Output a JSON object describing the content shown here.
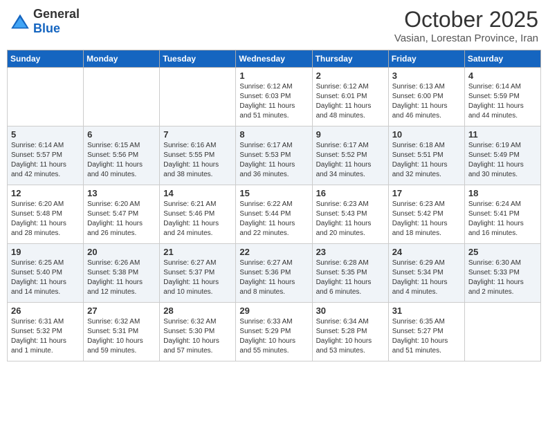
{
  "header": {
    "logo_general": "General",
    "logo_blue": "Blue",
    "month": "October 2025",
    "location": "Vasian, Lorestan Province, Iran"
  },
  "weekdays": [
    "Sunday",
    "Monday",
    "Tuesday",
    "Wednesday",
    "Thursday",
    "Friday",
    "Saturday"
  ],
  "weeks": [
    [
      {
        "day": "",
        "detail": ""
      },
      {
        "day": "",
        "detail": ""
      },
      {
        "day": "",
        "detail": ""
      },
      {
        "day": "1",
        "detail": "Sunrise: 6:12 AM\nSunset: 6:03 PM\nDaylight: 11 hours\nand 51 minutes."
      },
      {
        "day": "2",
        "detail": "Sunrise: 6:12 AM\nSunset: 6:01 PM\nDaylight: 11 hours\nand 48 minutes."
      },
      {
        "day": "3",
        "detail": "Sunrise: 6:13 AM\nSunset: 6:00 PM\nDaylight: 11 hours\nand 46 minutes."
      },
      {
        "day": "4",
        "detail": "Sunrise: 6:14 AM\nSunset: 5:59 PM\nDaylight: 11 hours\nand 44 minutes."
      }
    ],
    [
      {
        "day": "5",
        "detail": "Sunrise: 6:14 AM\nSunset: 5:57 PM\nDaylight: 11 hours\nand 42 minutes."
      },
      {
        "day": "6",
        "detail": "Sunrise: 6:15 AM\nSunset: 5:56 PM\nDaylight: 11 hours\nand 40 minutes."
      },
      {
        "day": "7",
        "detail": "Sunrise: 6:16 AM\nSunset: 5:55 PM\nDaylight: 11 hours\nand 38 minutes."
      },
      {
        "day": "8",
        "detail": "Sunrise: 6:17 AM\nSunset: 5:53 PM\nDaylight: 11 hours\nand 36 minutes."
      },
      {
        "day": "9",
        "detail": "Sunrise: 6:17 AM\nSunset: 5:52 PM\nDaylight: 11 hours\nand 34 minutes."
      },
      {
        "day": "10",
        "detail": "Sunrise: 6:18 AM\nSunset: 5:51 PM\nDaylight: 11 hours\nand 32 minutes."
      },
      {
        "day": "11",
        "detail": "Sunrise: 6:19 AM\nSunset: 5:49 PM\nDaylight: 11 hours\nand 30 minutes."
      }
    ],
    [
      {
        "day": "12",
        "detail": "Sunrise: 6:20 AM\nSunset: 5:48 PM\nDaylight: 11 hours\nand 28 minutes."
      },
      {
        "day": "13",
        "detail": "Sunrise: 6:20 AM\nSunset: 5:47 PM\nDaylight: 11 hours\nand 26 minutes."
      },
      {
        "day": "14",
        "detail": "Sunrise: 6:21 AM\nSunset: 5:46 PM\nDaylight: 11 hours\nand 24 minutes."
      },
      {
        "day": "15",
        "detail": "Sunrise: 6:22 AM\nSunset: 5:44 PM\nDaylight: 11 hours\nand 22 minutes."
      },
      {
        "day": "16",
        "detail": "Sunrise: 6:23 AM\nSunset: 5:43 PM\nDaylight: 11 hours\nand 20 minutes."
      },
      {
        "day": "17",
        "detail": "Sunrise: 6:23 AM\nSunset: 5:42 PM\nDaylight: 11 hours\nand 18 minutes."
      },
      {
        "day": "18",
        "detail": "Sunrise: 6:24 AM\nSunset: 5:41 PM\nDaylight: 11 hours\nand 16 minutes."
      }
    ],
    [
      {
        "day": "19",
        "detail": "Sunrise: 6:25 AM\nSunset: 5:40 PM\nDaylight: 11 hours\nand 14 minutes."
      },
      {
        "day": "20",
        "detail": "Sunrise: 6:26 AM\nSunset: 5:38 PM\nDaylight: 11 hours\nand 12 minutes."
      },
      {
        "day": "21",
        "detail": "Sunrise: 6:27 AM\nSunset: 5:37 PM\nDaylight: 11 hours\nand 10 minutes."
      },
      {
        "day": "22",
        "detail": "Sunrise: 6:27 AM\nSunset: 5:36 PM\nDaylight: 11 hours\nand 8 minutes."
      },
      {
        "day": "23",
        "detail": "Sunrise: 6:28 AM\nSunset: 5:35 PM\nDaylight: 11 hours\nand 6 minutes."
      },
      {
        "day": "24",
        "detail": "Sunrise: 6:29 AM\nSunset: 5:34 PM\nDaylight: 11 hours\nand 4 minutes."
      },
      {
        "day": "25",
        "detail": "Sunrise: 6:30 AM\nSunset: 5:33 PM\nDaylight: 11 hours\nand 2 minutes."
      }
    ],
    [
      {
        "day": "26",
        "detail": "Sunrise: 6:31 AM\nSunset: 5:32 PM\nDaylight: 11 hours\nand 1 minute."
      },
      {
        "day": "27",
        "detail": "Sunrise: 6:32 AM\nSunset: 5:31 PM\nDaylight: 10 hours\nand 59 minutes."
      },
      {
        "day": "28",
        "detail": "Sunrise: 6:32 AM\nSunset: 5:30 PM\nDaylight: 10 hours\nand 57 minutes."
      },
      {
        "day": "29",
        "detail": "Sunrise: 6:33 AM\nSunset: 5:29 PM\nDaylight: 10 hours\nand 55 minutes."
      },
      {
        "day": "30",
        "detail": "Sunrise: 6:34 AM\nSunset: 5:28 PM\nDaylight: 10 hours\nand 53 minutes."
      },
      {
        "day": "31",
        "detail": "Sunrise: 6:35 AM\nSunset: 5:27 PM\nDaylight: 10 hours\nand 51 minutes."
      },
      {
        "day": "",
        "detail": ""
      }
    ]
  ]
}
